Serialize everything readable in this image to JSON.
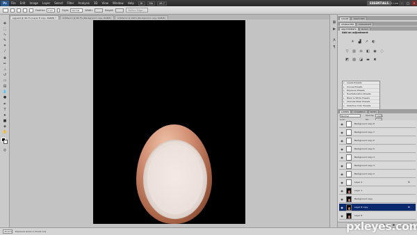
{
  "menubar": {
    "logo": "Ps",
    "items": [
      "File",
      "Edit",
      "Image",
      "Layer",
      "Select",
      "Filter",
      "Analysis",
      "3D",
      "View",
      "Window",
      "Help"
    ],
    "zoom_btn": "46.7",
    "workspace": "ESSENTIALS",
    "cs_live": "CS Live"
  },
  "options": {
    "feather_label": "Feather:",
    "feather_value": "0 px",
    "style_label": "Style:",
    "style_value": "Normal",
    "width_label": "Width:",
    "height_label": "Height:",
    "refine_button": "Refine Edge..."
  },
  "tabs": [
    {
      "label": "egg.psd @ 46.7% (Layer 8 copy, RGB/8) *",
      "active": true
    },
    {
      "label": "Untitled-1 @ 66.7% (Background copy, RGB/8)",
      "active": false
    },
    {
      "label": "Untitled-2 @ 100% (Background copy, RGB/8)",
      "active": false
    }
  ],
  "status": {
    "zoom": "46.67%",
    "info": "Exposure works in 32-bit only"
  },
  "panels": {
    "top_tabs": [
      "ADJUSTMENTS",
      "MASKS"
    ],
    "mid_tabs": [
      "CHARACTER",
      "PARAGRAPH"
    ],
    "adjust_title": "Add an adjustment",
    "presets": [
      "Levels Presets",
      "Curves Presets",
      "Exposure Presets",
      "Hue/Saturation Presets",
      "Black & White Presets",
      "Channel Mixer Presets",
      "Selective Color Presets"
    ],
    "layer_tabs": [
      "LAYERS",
      "CHANNELS",
      "PATHS"
    ],
    "blend_mode": "Normal",
    "opacity_label": "Opacity:",
    "opacity_value": "100%",
    "lock_label": "Lock:",
    "fill_label": "Fill:",
    "fill_value": "100%"
  },
  "layers": [
    {
      "name": "Background copy 8",
      "thumb": "white",
      "fx": false,
      "selected": false
    },
    {
      "name": "Background copy 7",
      "thumb": "white",
      "fx": false,
      "selected": false
    },
    {
      "name": "Background copy 6",
      "thumb": "white",
      "fx": false,
      "selected": false
    },
    {
      "name": "Background copy 5",
      "thumb": "white",
      "fx": false,
      "selected": false
    },
    {
      "name": "Background copy 4",
      "thumb": "white",
      "fx": false,
      "selected": false
    },
    {
      "name": "Background copy 3",
      "thumb": "white",
      "fx": false,
      "selected": false
    },
    {
      "name": "Background copy 2",
      "thumb": "white",
      "fx": false,
      "selected": false
    },
    {
      "name": "Layer 2",
      "thumb": "white",
      "fx": true,
      "selected": false
    },
    {
      "name": "Layer 1",
      "thumb": "dark",
      "fx": false,
      "selected": false
    },
    {
      "name": "Background copy",
      "thumb": "dark",
      "fx": false,
      "selected": false
    },
    {
      "name": "Layer 8 copy",
      "thumb": "dark",
      "fx": true,
      "selected": true
    },
    {
      "name": "Layer 8",
      "thumb": "dark",
      "fx": false,
      "selected": false
    }
  ],
  "watermark": "pxleyes.com"
}
